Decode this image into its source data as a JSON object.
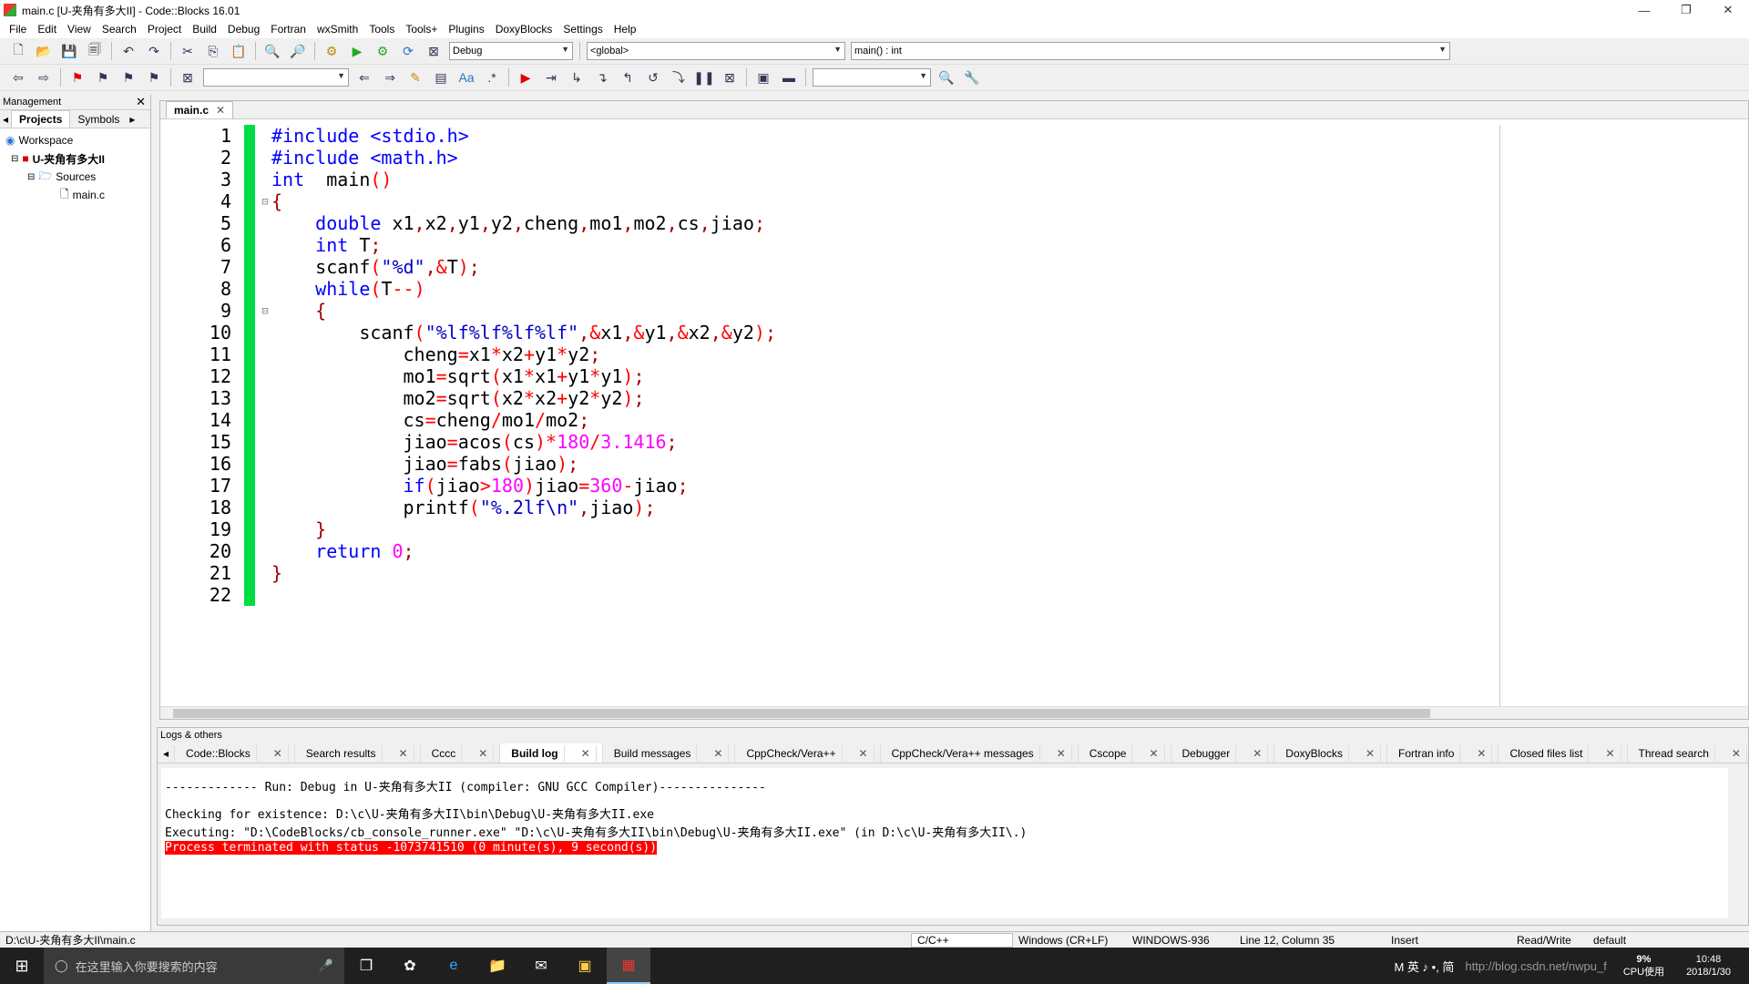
{
  "window": {
    "title": "main.c [U-夹角有多大II] - Code::Blocks 16.01",
    "minimize": "—",
    "maximize": "❐",
    "close": "✕"
  },
  "menu": [
    "File",
    "Edit",
    "View",
    "Search",
    "Project",
    "Build",
    "Debug",
    "Fortran",
    "wxSmith",
    "Tools",
    "Tools+",
    "Plugins",
    "DoxyBlocks",
    "Settings",
    "Help"
  ],
  "toolbar": {
    "build_target": "Debug",
    "scope": "<global>",
    "function": "main() : int"
  },
  "management": {
    "title": "Management",
    "tabs": [
      "Projects",
      "Symbols"
    ],
    "tree": {
      "workspace": "Workspace",
      "project": "U-夹角有多大II",
      "folder": "Sources",
      "file": "main.c"
    }
  },
  "editor": {
    "tab": "main.c",
    "lines": [
      [
        [
          "pp",
          "#include <stdio.h>"
        ]
      ],
      [
        [
          "pp",
          "#include <math.h>"
        ]
      ],
      [
        [
          "kw",
          "int"
        ],
        [
          "",
          "  main"
        ],
        [
          "op",
          "()"
        ]
      ],
      [
        [
          "sym",
          "{"
        ]
      ],
      [
        [
          "",
          "    "
        ],
        [
          "kw",
          "double"
        ],
        [
          "",
          " x1"
        ],
        [
          "sym",
          ","
        ],
        [
          "",
          "x2"
        ],
        [
          "sym",
          ","
        ],
        [
          "",
          "y1"
        ],
        [
          "sym",
          ","
        ],
        [
          "",
          "y2"
        ],
        [
          "sym",
          ","
        ],
        [
          "",
          "cheng"
        ],
        [
          "sym",
          ","
        ],
        [
          "",
          "mo1"
        ],
        [
          "sym",
          ","
        ],
        [
          "",
          "mo2"
        ],
        [
          "sym",
          ","
        ],
        [
          "",
          "cs"
        ],
        [
          "sym",
          ","
        ],
        [
          "",
          "jiao"
        ],
        [
          "sym",
          ";"
        ]
      ],
      [
        [
          "",
          "    "
        ],
        [
          "kw",
          "int"
        ],
        [
          "",
          " T"
        ],
        [
          "sym",
          ";"
        ]
      ],
      [
        [
          "",
          "    scanf"
        ],
        [
          "op",
          "("
        ],
        [
          "str",
          "\"%d\""
        ],
        [
          "sym",
          ","
        ],
        [
          "op",
          "&"
        ],
        [
          "",
          "T"
        ],
        [
          "op",
          ")"
        ],
        [
          "sym",
          ";"
        ]
      ],
      [
        [
          "",
          "    "
        ],
        [
          "kw",
          "while"
        ],
        [
          "op",
          "("
        ],
        [
          "",
          "T"
        ],
        [
          "op",
          "--)"
        ]
      ],
      [
        [
          "",
          "    "
        ],
        [
          "sym",
          "{"
        ]
      ],
      [
        [
          "",
          "        scanf"
        ],
        [
          "op",
          "("
        ],
        [
          "str",
          "\"%lf%lf%lf%lf\""
        ],
        [
          "sym",
          ","
        ],
        [
          "op",
          "&"
        ],
        [
          "",
          "x1"
        ],
        [
          "sym",
          ","
        ],
        [
          "op",
          "&"
        ],
        [
          "",
          "y1"
        ],
        [
          "sym",
          ","
        ],
        [
          "op",
          "&"
        ],
        [
          "",
          "x2"
        ],
        [
          "sym",
          ","
        ],
        [
          "op",
          "&"
        ],
        [
          "",
          "y2"
        ],
        [
          "op",
          ")"
        ],
        [
          "sym",
          ";"
        ]
      ],
      [
        [
          "",
          "            cheng"
        ],
        [
          "op",
          "="
        ],
        [
          "",
          "x1"
        ],
        [
          "op",
          "*"
        ],
        [
          "",
          "x2"
        ],
        [
          "op",
          "+"
        ],
        [
          "",
          "y1"
        ],
        [
          "op",
          "*"
        ],
        [
          "",
          "y2"
        ],
        [
          "sym",
          ";"
        ]
      ],
      [
        [
          "",
          "            mo1"
        ],
        [
          "op",
          "="
        ],
        [
          "",
          "sqrt"
        ],
        [
          "op",
          "("
        ],
        [
          "",
          "x1"
        ],
        [
          "op",
          "*"
        ],
        [
          "",
          "x1"
        ],
        [
          "op",
          "+"
        ],
        [
          "",
          "y1"
        ],
        [
          "op",
          "*"
        ],
        [
          "",
          "y1"
        ],
        [
          "op",
          ")"
        ],
        [
          "sym",
          ";"
        ]
      ],
      [
        [
          "",
          "            mo2"
        ],
        [
          "op",
          "="
        ],
        [
          "",
          "sqrt"
        ],
        [
          "op",
          "("
        ],
        [
          "",
          "x2"
        ],
        [
          "op",
          "*"
        ],
        [
          "",
          "x2"
        ],
        [
          "op",
          "+"
        ],
        [
          "",
          "y2"
        ],
        [
          "op",
          "*"
        ],
        [
          "",
          "y2"
        ],
        [
          "op",
          ")"
        ],
        [
          "sym",
          ";"
        ]
      ],
      [
        [
          "",
          "            cs"
        ],
        [
          "op",
          "="
        ],
        [
          "",
          "cheng"
        ],
        [
          "op",
          "/"
        ],
        [
          "",
          "mo1"
        ],
        [
          "op",
          "/"
        ],
        [
          "",
          "mo2"
        ],
        [
          "sym",
          ";"
        ]
      ],
      [
        [
          "",
          "            jiao"
        ],
        [
          "op",
          "="
        ],
        [
          "",
          "acos"
        ],
        [
          "op",
          "("
        ],
        [
          "",
          "cs"
        ],
        [
          "op",
          ")*"
        ],
        [
          "num",
          "180"
        ],
        [
          "op",
          "/"
        ],
        [
          "num",
          "3.1416"
        ],
        [
          "sym",
          ";"
        ]
      ],
      [
        [
          "",
          "            jiao"
        ],
        [
          "op",
          "="
        ],
        [
          "",
          "fabs"
        ],
        [
          "op",
          "("
        ],
        [
          "",
          "jiao"
        ],
        [
          "op",
          ")"
        ],
        [
          "sym",
          ";"
        ]
      ],
      [
        [
          "",
          "            "
        ],
        [
          "kw",
          "if"
        ],
        [
          "op",
          "("
        ],
        [
          "",
          "jiao"
        ],
        [
          "op",
          ">"
        ],
        [
          "num",
          "180"
        ],
        [
          "op",
          ")"
        ],
        [
          "",
          "jiao"
        ],
        [
          "op",
          "="
        ],
        [
          "num",
          "360"
        ],
        [
          "op",
          "-"
        ],
        [
          "",
          "jiao"
        ],
        [
          "sym",
          ";"
        ]
      ],
      [
        [
          "",
          "            printf"
        ],
        [
          "op",
          "("
        ],
        [
          "str",
          "\"%.2lf\\n\""
        ],
        [
          "sym",
          ","
        ],
        [
          "",
          "jiao"
        ],
        [
          "op",
          ")"
        ],
        [
          "sym",
          ";"
        ]
      ],
      [
        [
          "",
          "    "
        ],
        [
          "sym",
          "}"
        ]
      ],
      [
        [
          "",
          "    "
        ],
        [
          "kw",
          "return"
        ],
        [
          "",
          " "
        ],
        [
          "num",
          "0"
        ],
        [
          "sym",
          ";"
        ]
      ],
      [
        [
          "sym",
          "}"
        ]
      ],
      [
        [
          "",
          ""
        ]
      ]
    ]
  },
  "logs": {
    "title": "Logs & others",
    "tabs": [
      "Code::Blocks",
      "Search results",
      "Cccc",
      "Build log",
      "Build messages",
      "CppCheck/Vera++",
      "CppCheck/Vera++ messages",
      "Cscope",
      "Debugger",
      "DoxyBlocks",
      "Fortran info",
      "Closed files list",
      "Thread search"
    ],
    "active_tab": "Build log",
    "lines": [
      "------------- Run: Debug in U-夹角有多大II (compiler: GNU GCC Compiler)---------------",
      "",
      "Checking for existence: D:\\c\\U-夹角有多大II\\bin\\Debug\\U-夹角有多大II.exe",
      "Executing: \"D:\\CodeBlocks/cb_console_runner.exe\" \"D:\\c\\U-夹角有多大II\\bin\\Debug\\U-夹角有多大II.exe\"  (in D:\\c\\U-夹角有多大II\\.)"
    ],
    "error": "Process terminated with status -1073741510 (0 minute(s), 9 second(s))"
  },
  "status": {
    "path": "D:\\c\\U-夹角有多大II\\main.c",
    "lang": "C/C++",
    "eol": "Windows (CR+LF)",
    "encoding": "WINDOWS-936",
    "position": "Line 12, Column 35",
    "mode": "Insert",
    "access": "Read/Write",
    "profile": "default"
  },
  "taskbar": {
    "search_placeholder": "在这里输入你要搜索的内容",
    "ime": "M 英 ♪ •, 简",
    "cpu": "9%",
    "cpu_label": "CPU使用",
    "time": "10:48",
    "date": "2018/1/30",
    "watermark": "http://blog.csdn.net/nwpu_f"
  }
}
